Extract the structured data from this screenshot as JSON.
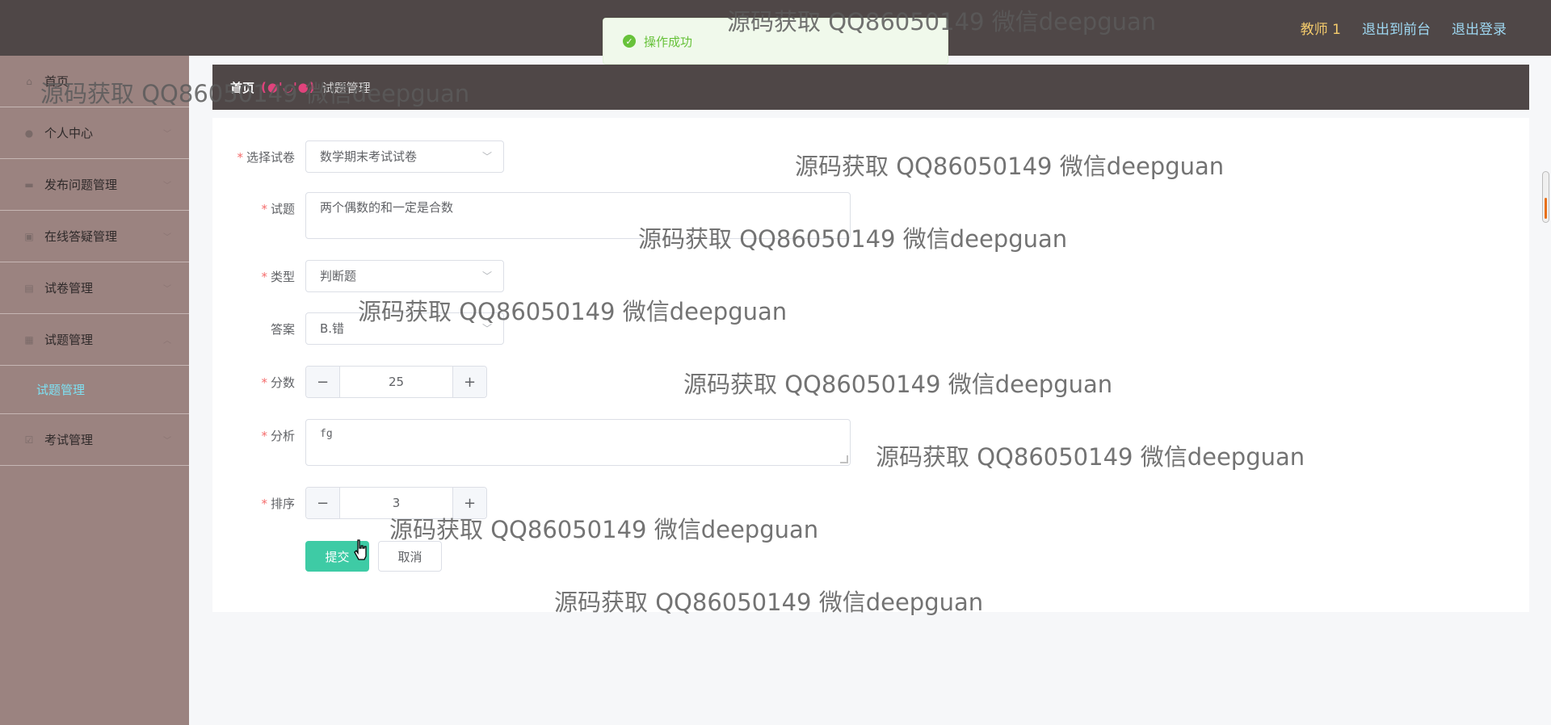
{
  "header": {
    "user": "教师 1",
    "links": [
      "退出到前台",
      "退出登录"
    ]
  },
  "toast": {
    "message": "操作成功"
  },
  "sidebar": {
    "items": [
      {
        "label": "首页"
      },
      {
        "label": "个人中心"
      },
      {
        "label": "发布问题管理"
      },
      {
        "label": "在线答疑管理"
      },
      {
        "label": "试卷管理"
      },
      {
        "label": "试题管理"
      },
      {
        "label": "考试管理"
      }
    ],
    "active_sub": "试题管理"
  },
  "breadcrumb": {
    "home": "首页",
    "separator": "(●'◡'●)",
    "current": "试题管理"
  },
  "form": {
    "paper_label": "选择试卷",
    "paper_value": "数学期末考试试卷",
    "question_label": "试题",
    "question_value": "两个偶数的和一定是合数",
    "type_label": "类型",
    "type_value": "判断题",
    "answer_label": "答案",
    "answer_value": "B.错",
    "score_label": "分数",
    "score_value": "25",
    "analysis_label": "分析",
    "analysis_value": "fg",
    "order_label": "排序",
    "order_value": "3",
    "submit_label": "提交",
    "cancel_label": "取消",
    "minus": "−",
    "plus": "+"
  },
  "watermark": "源码获取 QQ86050149 微信deepguan",
  "colors": {
    "header": "#4f4747",
    "sidebar": "#9b8380",
    "submit": "#3ecba5",
    "active_sub": "#7ee0f2",
    "user": "#f4cb6c"
  }
}
